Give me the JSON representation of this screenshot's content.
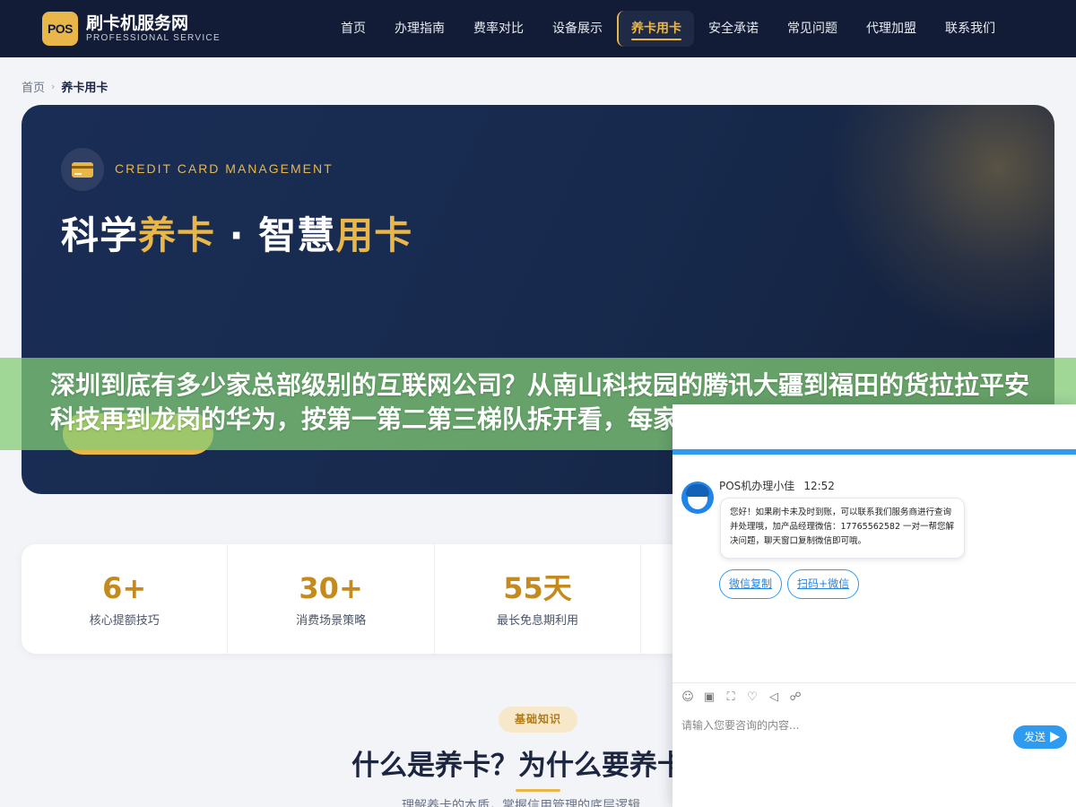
{
  "header": {
    "logo_mark": "POS",
    "logo_title": "刷卡机服务网",
    "logo_subtitle": "PROFESSIONAL SERVICE",
    "nav": [
      {
        "label": "首页"
      },
      {
        "label": "办理指南"
      },
      {
        "label": "费率对比"
      },
      {
        "label": "设备展示"
      },
      {
        "label": "养卡用卡",
        "active": true
      },
      {
        "label": "安全承诺"
      },
      {
        "label": "常见问题"
      },
      {
        "label": "代理加盟"
      },
      {
        "label": "联系我们"
      }
    ]
  },
  "breadcrumb": {
    "home": "首页",
    "separator": "›",
    "current": "养卡用卡"
  },
  "hero": {
    "eyebrow": "CREDIT CARD MANAGEMENT",
    "title_part1": "科学",
    "title_part2": "养卡",
    "title_part3": " · 智慧",
    "title_part4": "用卡",
    "icon": "credit-card-icon"
  },
  "stats": [
    {
      "value": "6+",
      "label": "核心提额技巧"
    },
    {
      "value": "30+",
      "label": "消费场景策略"
    },
    {
      "value": "55天",
      "label": "最长免息期利用"
    },
    {
      "value": "",
      "label": ""
    },
    {
      "value": "",
      "label": ""
    }
  ],
  "section": {
    "tag": "基础知识",
    "title": "什么是养卡？为什么要养卡",
    "subtitle": "理解养卡的本质，掌握信用管理的底层逻辑"
  },
  "banner": {
    "text": "深圳到底有多少家总部级别的互联网公司？从南山科技园的腾讯大疆到福田的货拉拉平安科技再到龙岗的华为，按第一第二第三梯队拆开看，每家"
  },
  "chat": {
    "agent_name": "POS机办理小佳",
    "time": "12:52",
    "message": "您好！如果刷卡未及时到账，可以联系我们服务商进行查询并处理哦，加产品经理微信：17765562582 一对一帮您解决问题，聊天窗口复制微信即可哦。",
    "quick_buttons": [
      "微信复制",
      "扫码+微信"
    ],
    "input_placeholder": "请输入您要咨询的内容...",
    "send_label": "发送",
    "accent_color": "#2f9bf0"
  },
  "colors": {
    "header_bg": "#121c36",
    "gold": "#e9b64a",
    "banner_green": "#83cd75"
  }
}
